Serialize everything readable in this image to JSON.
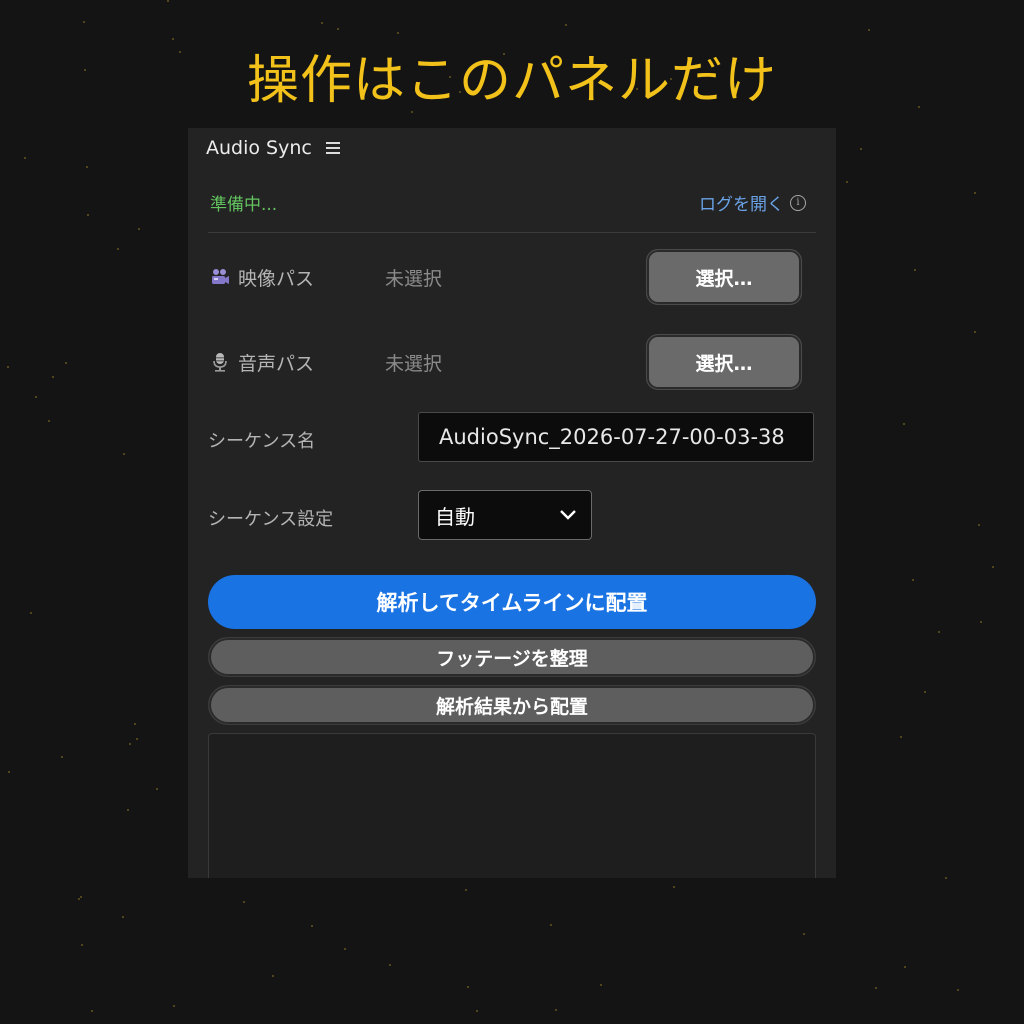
{
  "headline": "操作はこのパネルだけ",
  "panel": {
    "title": "Audio Sync",
    "menu_icon": "hamburger-icon",
    "status": "準備中...",
    "log_link": "ログを開く",
    "info_icon": "info-icon"
  },
  "video_path": {
    "icon": "video-camera-icon",
    "label": "映像パス",
    "value": "未選択",
    "button": "選択…"
  },
  "audio_path": {
    "icon": "microphone-icon",
    "label": "音声パス",
    "value": "未選択",
    "button": "選択…"
  },
  "sequence_name": {
    "label": "シーケンス名",
    "value": "AudioSync_2026-07-27-00-03-38"
  },
  "sequence_setting": {
    "label": "シーケンス設定",
    "selected": "自動",
    "icon": "chevron-down-icon"
  },
  "actions": {
    "analyze": "解析してタイムラインに配置",
    "organize": "フッテージを整理",
    "place_from_results": "解析結果から配置"
  },
  "colors": {
    "headline": "#f2c21b",
    "status": "#62c35f",
    "link": "#6aa3e8",
    "primary": "#1a73e3"
  }
}
